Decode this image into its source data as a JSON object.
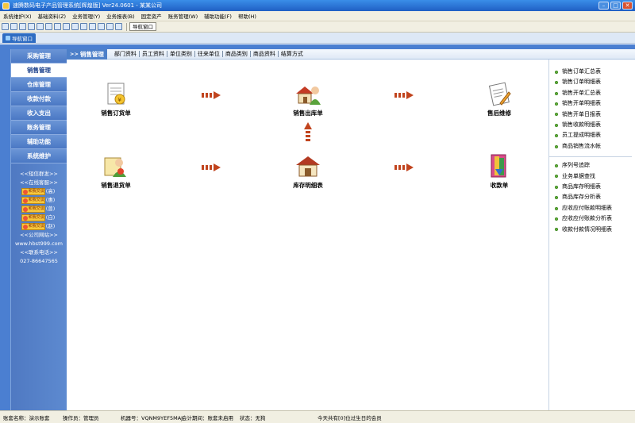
{
  "window": {
    "title": "速腾数码电子产品管理系统[辉煌版] Ver24.0601 - 某某公司",
    "minimize": "–",
    "maximize": "□",
    "close": "✕"
  },
  "menu": [
    "系统维护(X)",
    "基础资料(Z)",
    "业务管理(Y)",
    "业务报表(B)",
    "固定资产",
    "账务管理(W)",
    "辅助功能(F)",
    "帮助(H)"
  ],
  "toolbar": {
    "nav_window_label": "导航窗口",
    "icons": [
      "new-icon",
      "open-icon",
      "list-icon",
      "chart-icon",
      "tools-icon",
      "user-icon",
      "print-icon",
      "pen-icon",
      "doc-icon",
      "save-icon",
      "calc-icon",
      "table-icon",
      "help-icon",
      "info-icon"
    ]
  },
  "tab": {
    "label": "导航窗口"
  },
  "sidebar": {
    "items": [
      {
        "label": "采购管理",
        "active": false
      },
      {
        "label": "销售管理",
        "active": true
      },
      {
        "label": "仓库管理",
        "active": false
      },
      {
        "label": "收款付款",
        "active": false
      },
      {
        "label": "收入支出",
        "active": false
      },
      {
        "label": "账务管理",
        "active": false
      },
      {
        "label": "辅助功能",
        "active": false
      },
      {
        "label": "系统维护",
        "active": false
      }
    ],
    "sms": "<<短信群发>>",
    "online_service": "<<在线客服>>",
    "qq_text": "和我交谈",
    "qq_tags": [
      "(高)",
      "(惠)",
      "(曾)",
      "(白)",
      "(赵)"
    ],
    "website_label": "<<公司网站>>",
    "website": "www.hbst999.com",
    "phone_label": "<<联系电话>>",
    "phone": "027-86647565"
  },
  "subnav": {
    "current": "销售管理",
    "prefix": ">>",
    "links": [
      "部门资料",
      "员工资料",
      "单位类别",
      "往来单位",
      "商品类别",
      "商品资料",
      "结算方式"
    ]
  },
  "flow": {
    "nodes": [
      {
        "label": "销售订货单",
        "icon": "sales-order-icon"
      },
      {
        "label": "销售出库单",
        "icon": "sales-outbound-icon"
      },
      {
        "label": "售后维修",
        "icon": "after-sales-repair-icon"
      },
      {
        "label": "销售退货单",
        "icon": "sales-return-icon"
      },
      {
        "label": "库存明细表",
        "icon": "inventory-detail-icon"
      },
      {
        "label": "收款单",
        "icon": "receipt-icon"
      }
    ]
  },
  "right_panel": {
    "group1": [
      "销售订单汇总表",
      "销售订单明细表",
      "销售开单汇总表",
      "销售开单明细表",
      "销售开单日报表",
      "销售收款明细表",
      "员工提成明细表",
      "商品销售流水帐"
    ],
    "group2": [
      "序列号追踪",
      "业务单据查找",
      "商品库存明细表",
      "商品库存分析表",
      "应收应付账款明细表",
      "应收应付账款分析表",
      "收款付款情况明细表"
    ]
  },
  "status": {
    "account": "账套名称：演示账套",
    "operator": "操作员：管理员",
    "machine": "机器号：VQNM9YEF5MAJ",
    "period": "会计期间：账套未启用",
    "state": "状态：无狗",
    "birthday": "今天共有[0]位过生日的会员"
  },
  "colors": {
    "title_bar": "#1f5fc4",
    "sidebar": "#4b7fd1",
    "arrow": "#c1441e"
  }
}
